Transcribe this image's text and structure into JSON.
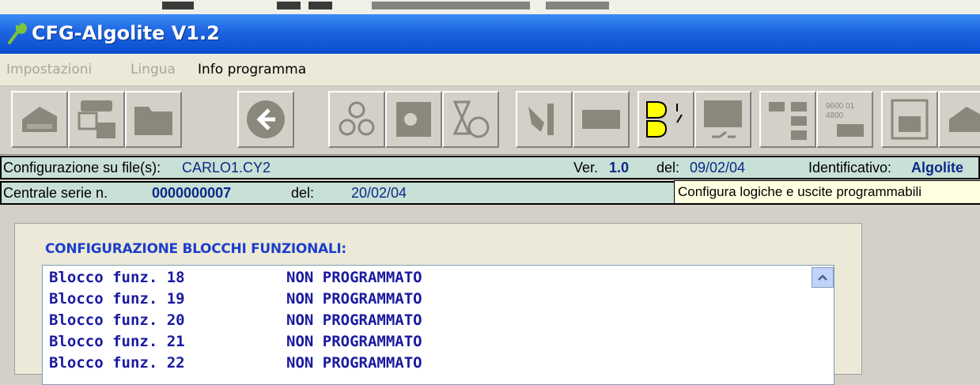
{
  "window": {
    "title": "CFG-Algolite V1.2"
  },
  "menu": [
    {
      "label": "Impostazioni",
      "enabled": false
    },
    {
      "label": "Lingua",
      "enabled": false
    },
    {
      "label": "Info programma",
      "enabled": true
    }
  ],
  "info": {
    "config_label": "Configurazione su file(s):",
    "config_file": "CARLO1.CY2",
    "ver_label": "Ver.",
    "ver_value": "1.0",
    "del_label": "del:",
    "del_value": "09/02/04",
    "id_label": "Identificativo:",
    "id_value": "Algolite",
    "serial_label": "Centrale serie n.",
    "serial_value": "0000000007",
    "serial_del_label": "del:",
    "serial_del_value": "20/02/04"
  },
  "tooltip": "Configura logiche e uscite programmabili",
  "panel": {
    "title": "CONFIGURAZIONE BLOCCHI FUNZIONALI:",
    "rows": [
      {
        "block": "Blocco funz. 18",
        "status": "NON PROGRAMMATO"
      },
      {
        "block": "Blocco funz. 19",
        "status": "NON PROGRAMMATO"
      },
      {
        "block": "Blocco funz. 20",
        "status": "NON PROGRAMMATO"
      },
      {
        "block": "Blocco funz. 21",
        "status": "NON PROGRAMMATO"
      },
      {
        "block": "Blocco funz. 22",
        "status": "NON PROGRAMMATO"
      }
    ]
  },
  "colors": {
    "titlebar": "#0a4dcf",
    "infobar": "#c9e0d6",
    "listtext": "#1a1aa0",
    "paneltitle": "#1c3fc9"
  }
}
